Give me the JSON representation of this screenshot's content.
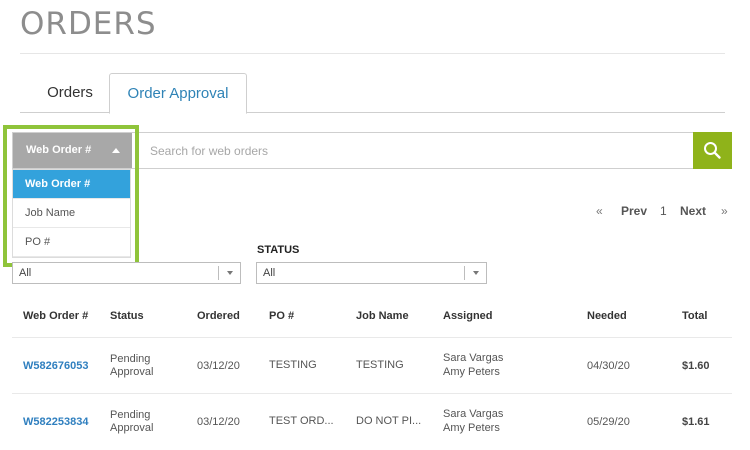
{
  "page": {
    "title": "ORDERS"
  },
  "tabs": [
    {
      "label": "Orders",
      "active": false
    },
    {
      "label": "Order Approval",
      "active": true
    }
  ],
  "search": {
    "field_selected": "Web Order #",
    "placeholder": "Search for web orders",
    "options": [
      "Web Order #",
      "Job Name",
      "PO #"
    ],
    "highlight_color": "#8fc43a",
    "button_icon": "search-icon"
  },
  "pagination": {
    "first": "«",
    "prev": "Prev",
    "page": "1",
    "next": "Next",
    "last": "»"
  },
  "filters": {
    "first": {
      "value": "All"
    },
    "status": {
      "label": "STATUS",
      "value": "All"
    }
  },
  "table": {
    "headers": {
      "web_order": "Web Order #",
      "status": "Status",
      "ordered": "Ordered",
      "po": "PO #",
      "job_name": "Job Name",
      "assigned": "Assigned",
      "needed": "Needed",
      "total": "Total"
    },
    "rows": [
      {
        "web_order": "W582676053",
        "status_line1": "Pending",
        "status_line2": "Approval",
        "ordered": "03/12/20",
        "po": "TESTING",
        "job_name": "TESTING",
        "assigned_line1": "Sara Vargas",
        "assigned_line2": "Amy Peters",
        "needed": "04/30/20",
        "total": "$1.60"
      },
      {
        "web_order": "W582253834",
        "status_line1": "Pending",
        "status_line2": "Approval",
        "ordered": "03/12/20",
        "po": "TEST ORD...",
        "job_name": "DO NOT PI...",
        "assigned_line1": "Sara Vargas",
        "assigned_line2": "Amy Peters",
        "needed": "05/29/20",
        "total": "$1.61"
      }
    ]
  },
  "colors": {
    "accent_blue": "#2f83b6",
    "search_green": "#8fb31a",
    "dropdown_active": "#33a2dc"
  }
}
